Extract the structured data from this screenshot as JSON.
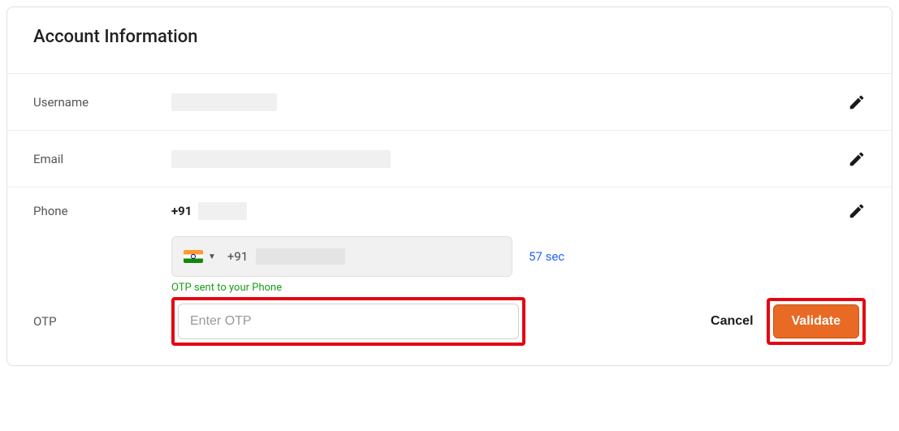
{
  "title": "Account Information",
  "labels": {
    "username": "Username",
    "email": "Email",
    "phone": "Phone",
    "otp": "OTP"
  },
  "phone": {
    "code": "+91",
    "combo_code": "+91",
    "timer": "57 sec",
    "otp_sent_msg": "OTP sent to your Phone",
    "otp_placeholder": "Enter OTP"
  },
  "actions": {
    "cancel": "Cancel",
    "validate": "Validate"
  }
}
